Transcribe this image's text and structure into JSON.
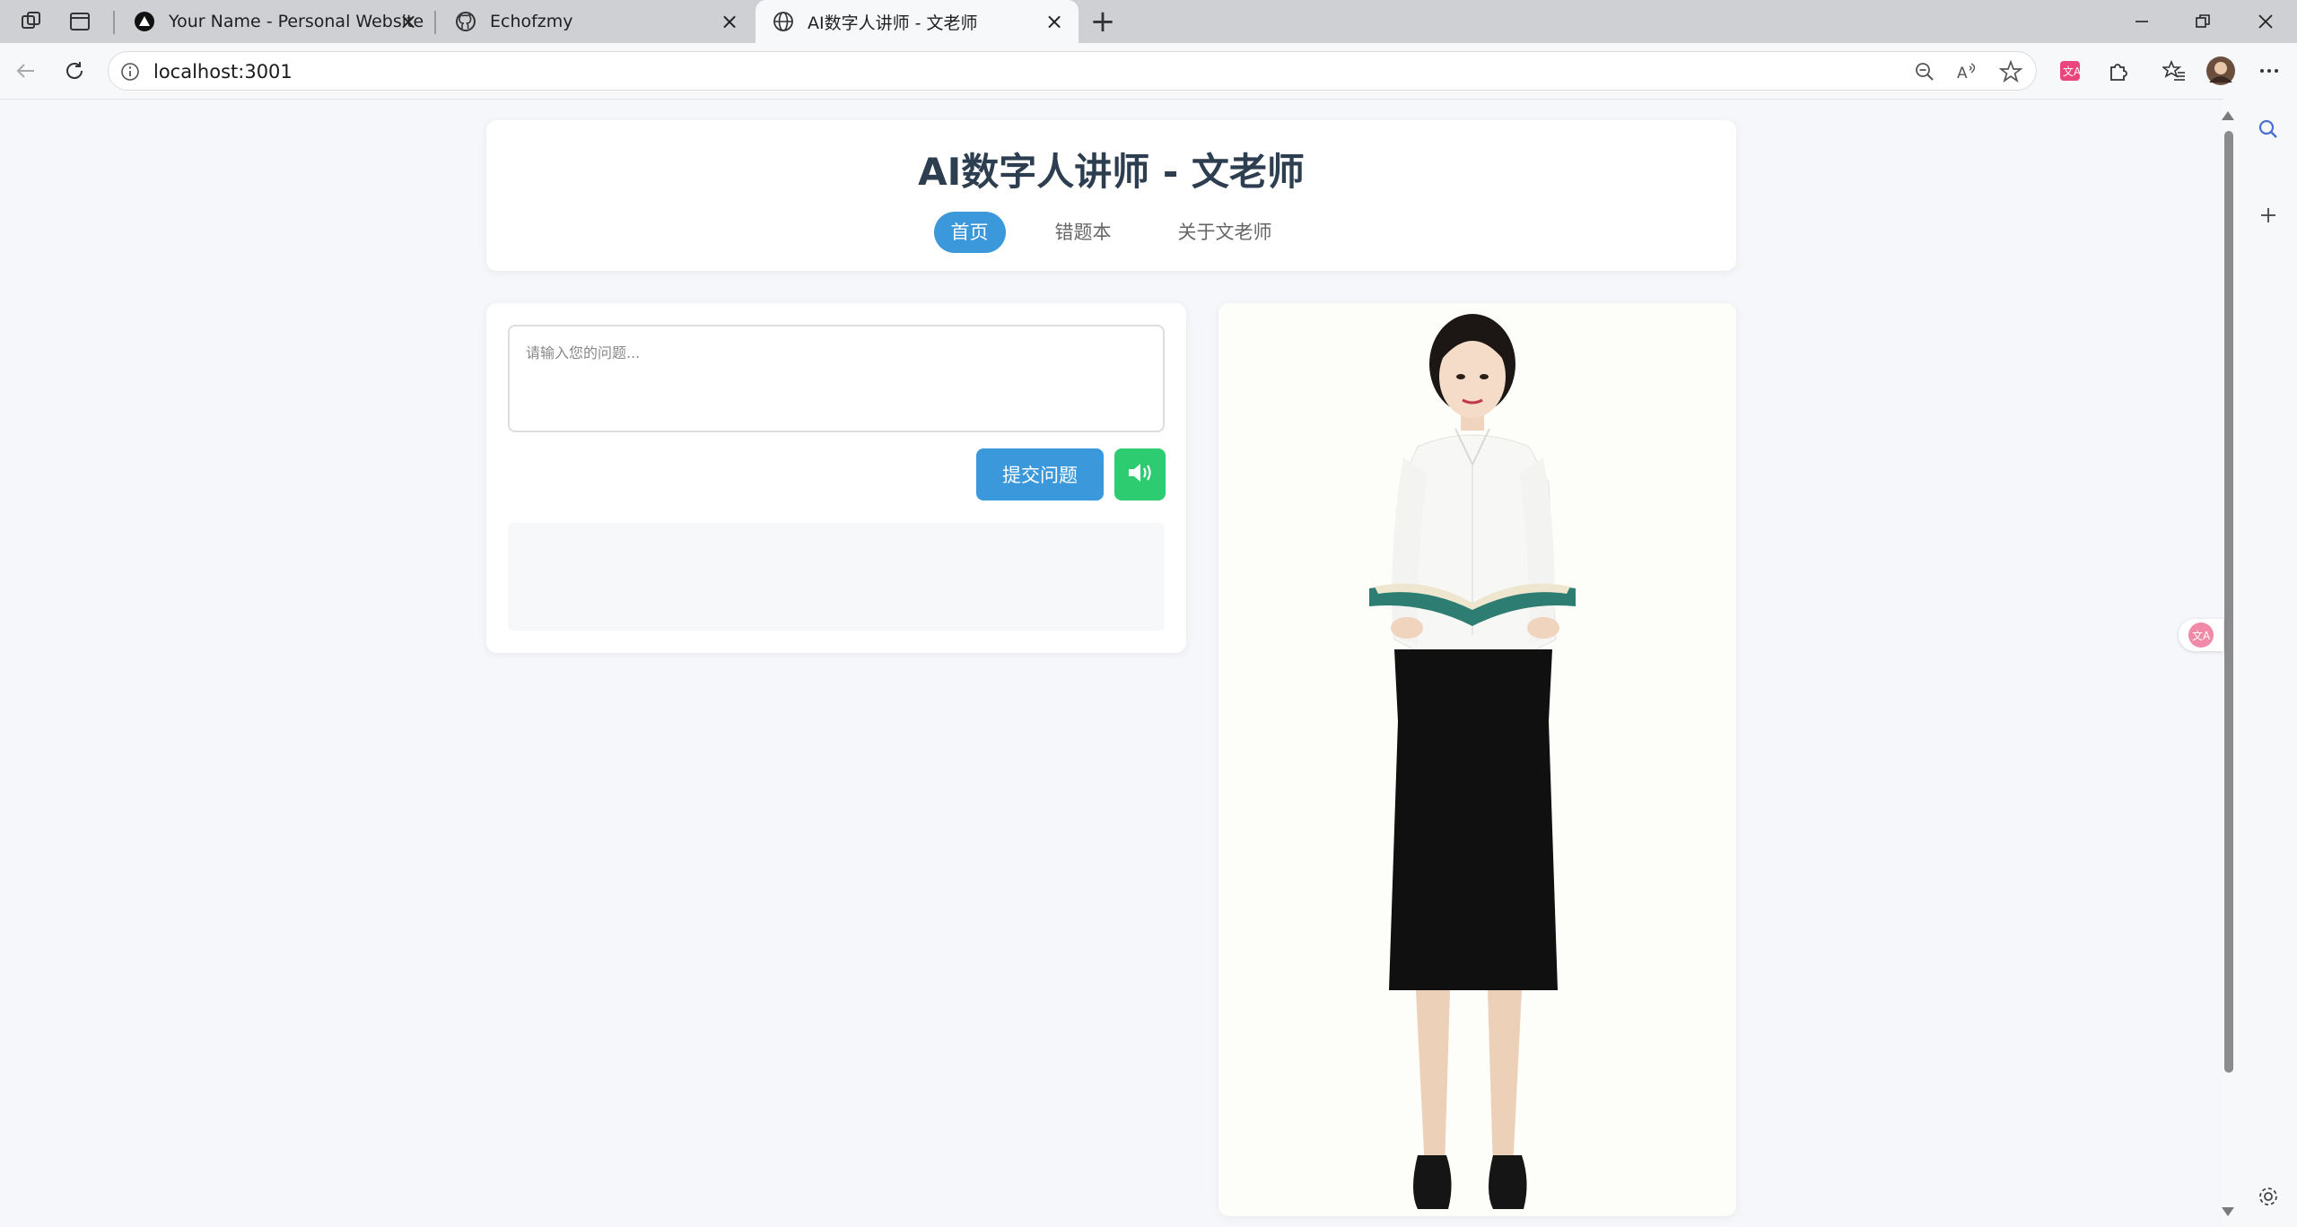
{
  "browser": {
    "tabs": [
      {
        "title": "Your Name - Personal Website",
        "icon": "triangle-logo-icon"
      },
      {
        "title": "Echofzmy",
        "icon": "github-icon"
      },
      {
        "title": "AI数字人讲师 - 文老师",
        "icon": "globe-icon",
        "active": true
      }
    ],
    "url": "localhost:3001"
  },
  "page": {
    "title": "AI数字人讲师 - 文老师",
    "nav": [
      {
        "label": "首页",
        "active": true
      },
      {
        "label": "错题本"
      },
      {
        "label": "关于文老师"
      }
    ],
    "question_placeholder": "请输入您的问题...",
    "submit_label": "提交问题",
    "speak_icon": "speaker-icon"
  },
  "colors": {
    "primary": "#3a98db",
    "speak": "#2ecc71",
    "title": "#2c3e50",
    "page_bg": "#f6f7fa"
  }
}
